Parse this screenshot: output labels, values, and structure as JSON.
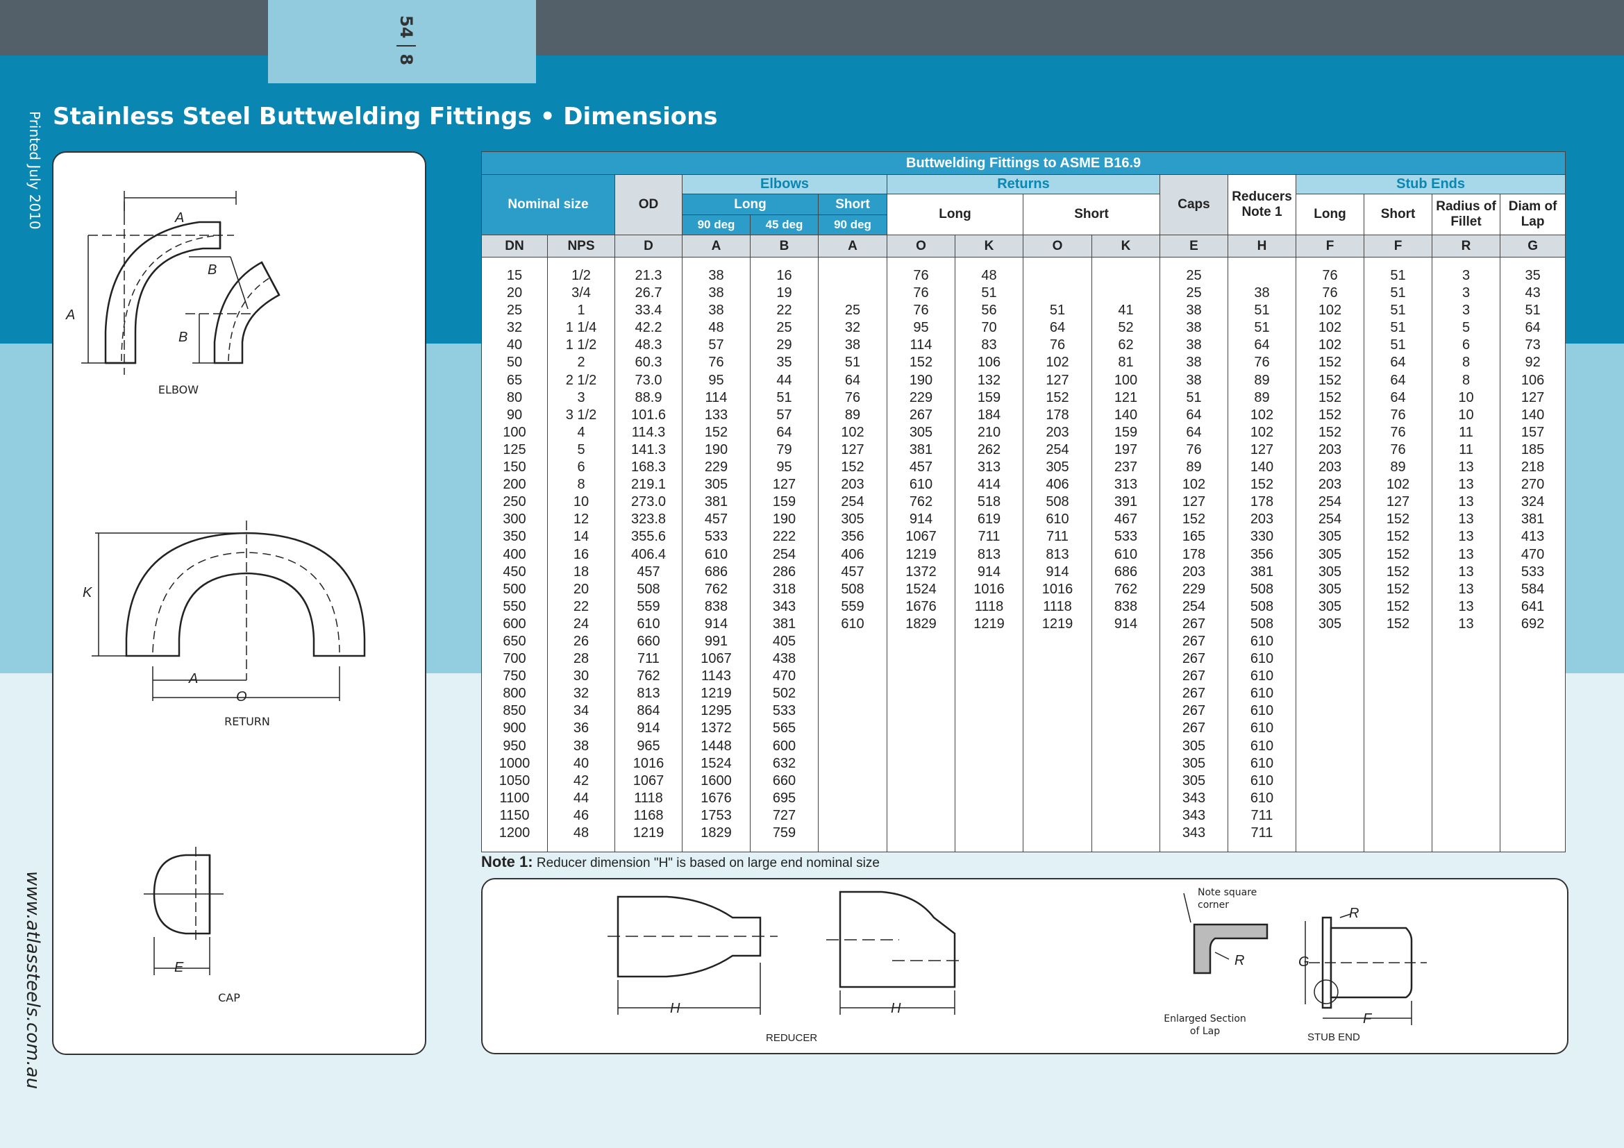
{
  "page": {
    "page_number": "54",
    "section_number": "8",
    "title": "Stainless Steel Buttwelding Fittings • Dimensions",
    "printed": "Printed July 2010",
    "website": "www.atlassteels.com.au"
  },
  "diagram_labels": {
    "elbow": "ELBOW",
    "return": "RETURN",
    "cap": "CAP",
    "reducer": "REDUCER",
    "stub_end": "STUB END",
    "enlarged_section": "Enlarged Section of Lap",
    "note_square_corner": "Note square corner",
    "dim_a": "A",
    "dim_b": "B",
    "dim_k": "K",
    "dim_o": "O",
    "dim_e": "E",
    "dim_h": "H",
    "dim_r": "R",
    "dim_g": "G",
    "dim_f": "F"
  },
  "table": {
    "caption": "Buttwelding Fittings to ASME B16.9",
    "groups": {
      "nominal": "Nominal size",
      "od": "OD",
      "elbows": "Elbows",
      "returns": "Returns",
      "caps": "Caps",
      "reducers": "Reducers Note 1",
      "stub_ends": "Stub Ends"
    },
    "subgroups": {
      "elbow_long": "Long",
      "elbow_short": "Short",
      "return_long": "Long",
      "return_short": "Short",
      "stub_long": "Long",
      "stub_short": "Short",
      "stub_radius": "Radius of Fillet",
      "stub_diam": "Diam of Lap"
    },
    "angles": {
      "long90": "90 deg",
      "long45": "45 deg",
      "short90": "90 deg"
    },
    "letters": [
      "DN",
      "NPS",
      "D",
      "A",
      "B",
      "A",
      "O",
      "K",
      "O",
      "K",
      "E",
      "H",
      "F",
      "F",
      "R",
      "G"
    ],
    "columns": {
      "dn": [
        "15",
        "20",
        "25",
        "32",
        "40",
        "50",
        "65",
        "80",
        "90",
        "100",
        "125",
        "150",
        "200",
        "250",
        "300",
        "350",
        "400",
        "450",
        "500",
        "550",
        "600",
        "650",
        "700",
        "750",
        "800",
        "850",
        "900",
        "950",
        "1000",
        "1050",
        "1100",
        "1150",
        "1200"
      ],
      "nps": [
        "1/2",
        "3/4",
        "1",
        "1 1/4",
        "1 1/2",
        "2",
        "2 1/2",
        "3",
        "3 1/2",
        "4",
        "5",
        "6",
        "8",
        "10",
        "12",
        "14",
        "16",
        "18",
        "20",
        "22",
        "24",
        "26",
        "28",
        "30",
        "32",
        "34",
        "36",
        "38",
        "40",
        "42",
        "44",
        "46",
        "48"
      ],
      "od": [
        "21.3",
        "26.7",
        "33.4",
        "42.2",
        "48.3",
        "60.3",
        "73.0",
        "88.9",
        "101.6",
        "114.3",
        "141.3",
        "168.3",
        "219.1",
        "273.0",
        "323.8",
        "355.6",
        "406.4",
        "457",
        "508",
        "559",
        "610",
        "660",
        "711",
        "762",
        "813",
        "864",
        "914",
        "965",
        "1016",
        "1067",
        "1118",
        "1168",
        "1219"
      ],
      "elbow_long_90_a": [
        "38",
        "38",
        "38",
        "48",
        "57",
        "76",
        "95",
        "114",
        "133",
        "152",
        "190",
        "229",
        "305",
        "381",
        "457",
        "533",
        "610",
        "686",
        "762",
        "838",
        "914",
        "991",
        "1067",
        "1143",
        "1219",
        "1295",
        "1372",
        "1448",
        "1524",
        "1600",
        "1676",
        "1753",
        "1829"
      ],
      "elbow_long_45_b": [
        "16",
        "19",
        "22",
        "25",
        "29",
        "35",
        "44",
        "51",
        "57",
        "64",
        "79",
        "95",
        "127",
        "159",
        "190",
        "222",
        "254",
        "286",
        "318",
        "343",
        "381",
        "405",
        "438",
        "470",
        "502",
        "533",
        "565",
        "600",
        "632",
        "660",
        "695",
        "727",
        "759"
      ],
      "elbow_short_90_a": [
        "",
        "",
        "25",
        "32",
        "38",
        "51",
        "64",
        "76",
        "89",
        "102",
        "127",
        "152",
        "203",
        "254",
        "305",
        "356",
        "406",
        "457",
        "508",
        "559",
        "610"
      ],
      "return_long_o": [
        "76",
        "76",
        "76",
        "95",
        "114",
        "152",
        "190",
        "229",
        "267",
        "305",
        "381",
        "457",
        "610",
        "762",
        "914",
        "1067",
        "1219",
        "1372",
        "1524",
        "1676",
        "1829"
      ],
      "return_long_k": [
        "48",
        "51",
        "56",
        "70",
        "83",
        "106",
        "132",
        "159",
        "184",
        "210",
        "262",
        "313",
        "414",
        "518",
        "619",
        "711",
        "813",
        "914",
        "1016",
        "1118",
        "1219"
      ],
      "return_short_o": [
        "",
        "",
        "51",
        "64",
        "76",
        "102",
        "127",
        "152",
        "178",
        "203",
        "254",
        "305",
        "406",
        "508",
        "610",
        "711",
        "813",
        "914",
        "1016",
        "1118",
        "1219"
      ],
      "return_short_k": [
        "",
        "",
        "41",
        "52",
        "62",
        "81",
        "100",
        "121",
        "140",
        "159",
        "197",
        "237",
        "313",
        "391",
        "467",
        "533",
        "610",
        "686",
        "762",
        "838",
        "914"
      ],
      "caps_e": [
        "25",
        "25",
        "38",
        "38",
        "38",
        "38",
        "38",
        "51",
        "64",
        "64",
        "76",
        "89",
        "102",
        "127",
        "152",
        "165",
        "178",
        "203",
        "229",
        "254",
        "267",
        "267",
        "267",
        "267",
        "267",
        "267",
        "267",
        "305",
        "305",
        "305",
        "343",
        "343",
        "343"
      ],
      "reducers_h": [
        "",
        "38",
        "51",
        "51",
        "64",
        "76",
        "89",
        "89",
        "102",
        "102",
        "127",
        "140",
        "152",
        "178",
        "203",
        "330",
        "356",
        "381",
        "508",
        "508",
        "508",
        "610",
        "610",
        "610",
        "610",
        "610",
        "610",
        "610",
        "610",
        "610",
        "610",
        "711",
        "711"
      ],
      "stub_long_f": [
        "76",
        "76",
        "102",
        "102",
        "102",
        "152",
        "152",
        "152",
        "152",
        "152",
        "203",
        "203",
        "203",
        "254",
        "254",
        "305",
        "305",
        "305",
        "305",
        "305",
        "305"
      ],
      "stub_short_f": [
        "51",
        "51",
        "51",
        "51",
        "51",
        "64",
        "64",
        "64",
        "76",
        "76",
        "76",
        "89",
        "102",
        "127",
        "152",
        "152",
        "152",
        "152",
        "152",
        "152",
        "152"
      ],
      "stub_radius_r": [
        "3",
        "3",
        "3",
        "5",
        "6",
        "8",
        "8",
        "10",
        "10",
        "11",
        "11",
        "13",
        "13",
        "13",
        "13",
        "13",
        "13",
        "13",
        "13",
        "13",
        "13"
      ],
      "stub_diam_g": [
        "35",
        "43",
        "51",
        "64",
        "73",
        "92",
        "106",
        "127",
        "140",
        "157",
        "185",
        "218",
        "270",
        "324",
        "381",
        "413",
        "470",
        "533",
        "584",
        "641",
        "692"
      ]
    }
  },
  "note": {
    "label": "Note 1:",
    "text": "Reducer dimension \"H\" is based on large end nominal size"
  }
}
